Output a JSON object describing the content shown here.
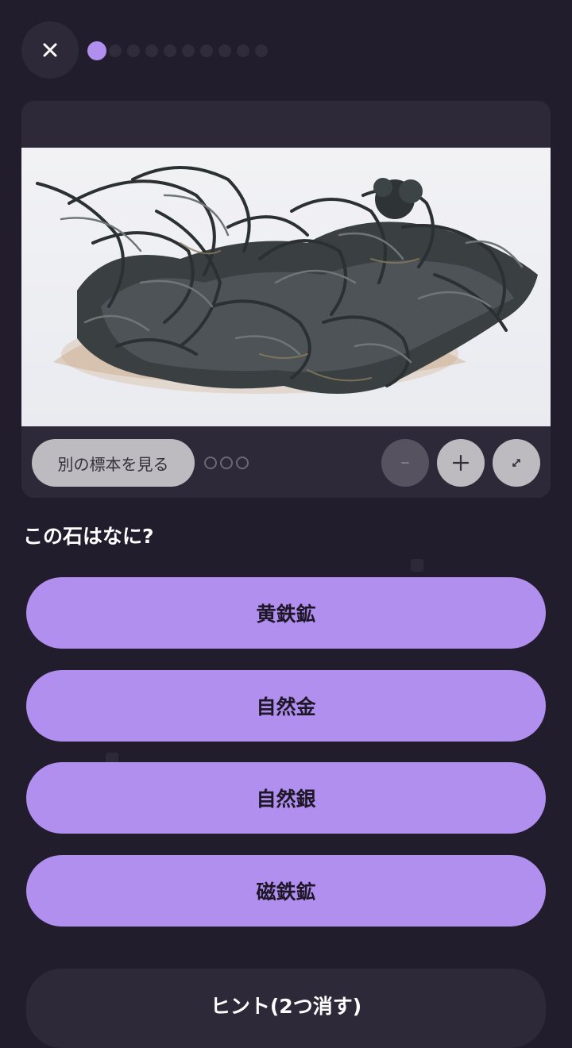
{
  "header": {
    "close_icon": "close-icon",
    "progress": {
      "total": 10,
      "current": 1
    }
  },
  "specimen": {
    "image": "wire-silver-specimen-photo",
    "other_label": "別の標本を見る",
    "variant_count": 3,
    "controls": {
      "zoom_out": "minus-icon",
      "zoom_in": "plus-icon",
      "expand": "expand-icon"
    }
  },
  "quiz": {
    "question": "この石はなに?",
    "answers": [
      "黄鉄鉱",
      "自然金",
      "自然銀",
      "磁鉄鉱"
    ],
    "hint_label": "ヒント(2つ消す)"
  },
  "colors": {
    "background": "#221d2d",
    "surface": "#2e2939",
    "accent": "#b18fee"
  }
}
